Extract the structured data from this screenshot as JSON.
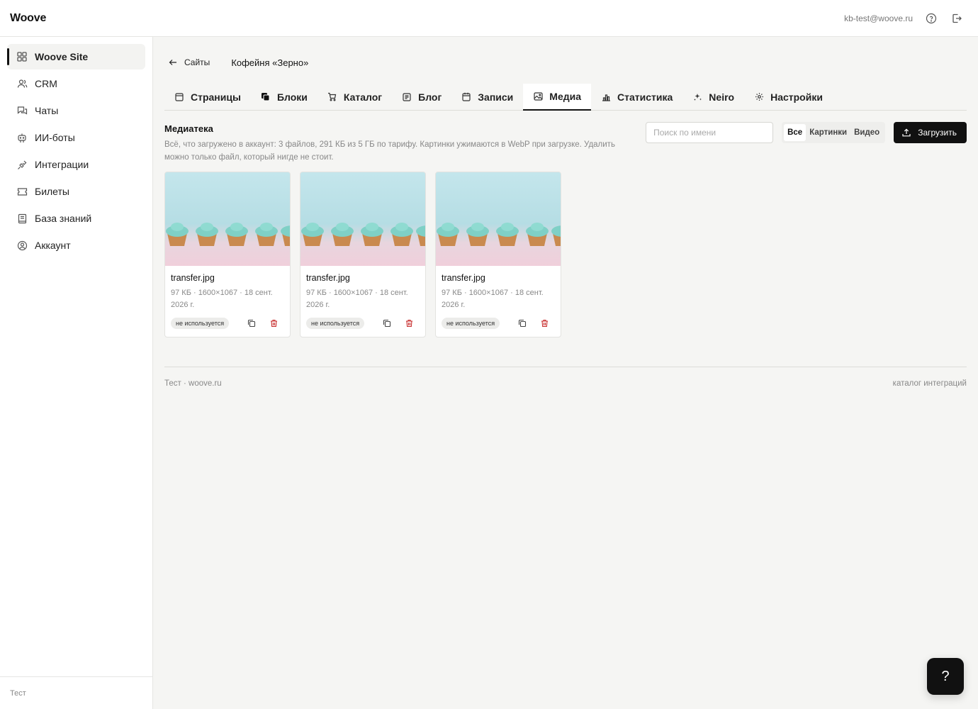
{
  "app": {
    "logo": "Woove"
  },
  "topbar": {
    "user_email": "kb-test@woove.ru",
    "help_icon": "help-circle-icon",
    "logout_icon": "logout-icon"
  },
  "sidebar": {
    "items": [
      {
        "label": "Woove Site",
        "icon": "grid-icon",
        "active": true
      },
      {
        "label": "CRM",
        "icon": "users-icon"
      },
      {
        "label": "Чаты",
        "icon": "chat-icon"
      },
      {
        "label": "ИИ-боты",
        "icon": "bot-icon"
      },
      {
        "label": "Интеграции",
        "icon": "plug-icon"
      },
      {
        "label": "Билеты",
        "icon": "ticket-icon"
      },
      {
        "label": "База знаний",
        "icon": "book-icon"
      },
      {
        "label": "Аккаунт",
        "icon": "account-icon"
      }
    ],
    "footer": "Тест"
  },
  "breadcrumb": {
    "back_label": "Сайты",
    "site_title": "Кофейня «Зерно»"
  },
  "tabs": [
    {
      "label": "Страницы",
      "icon": "page-icon"
    },
    {
      "label": "Блоки",
      "icon": "blocks-icon"
    },
    {
      "label": "Каталог",
      "icon": "cart-icon"
    },
    {
      "label": "Блог",
      "icon": "blog-icon"
    },
    {
      "label": "Записи",
      "icon": "calendar-icon"
    },
    {
      "label": "Медиа",
      "icon": "image-icon",
      "active": true
    },
    {
      "label": "Статистика",
      "icon": "chart-icon"
    },
    {
      "label": "Neiro",
      "icon": "sparkle-icon"
    },
    {
      "label": "Настройки",
      "icon": "gear-icon"
    }
  ],
  "library": {
    "title": "Медиатека",
    "description": "Всё, что загружено в аккаунт: 3 файлов, 291 КБ из 5 ГБ по тарифу. Картинки ужимаются в WebP при загрузке. Удалить можно только файл, который нигде не стоит.",
    "search_placeholder": "Поиск по имени",
    "filters": [
      {
        "label": "Все",
        "active": true
      },
      {
        "label": "Картинки"
      },
      {
        "label": "Видео"
      }
    ],
    "upload_label": "Загрузить"
  },
  "media": [
    {
      "name": "transfer.jpg",
      "meta": "97 КБ · 1600×1067 · 18 сент. 2026 г.",
      "badge": "не используется"
    },
    {
      "name": "transfer.jpg",
      "meta": "97 КБ · 1600×1067 · 18 сент. 2026 г.",
      "badge": "не используется"
    },
    {
      "name": "transfer.jpg",
      "meta": "97 КБ · 1600×1067 · 18 сент. 2026 г.",
      "badge": "не используется"
    }
  ],
  "footer": {
    "left": "Тест · woove.ru",
    "right": "каталог интеграций"
  },
  "help_fab": "?",
  "colors": {
    "accent": "#111111",
    "danger": "#c62828",
    "background": "#f5f5f3"
  }
}
